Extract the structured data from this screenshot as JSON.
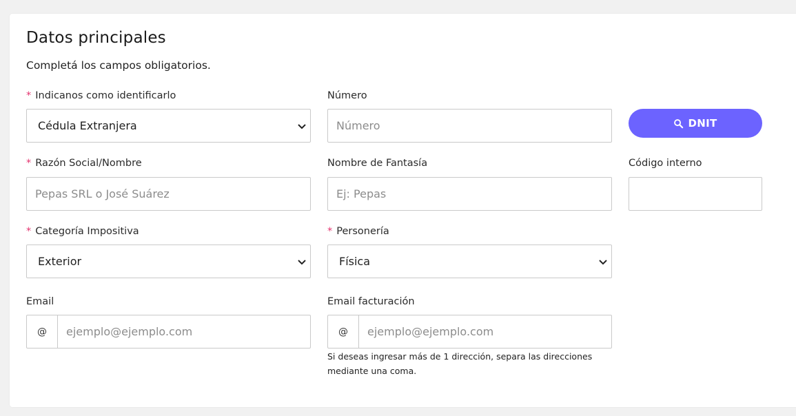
{
  "section": {
    "title": "Datos principales",
    "subtitle": "Completá los campos obligatorios."
  },
  "fields": {
    "identificacion": {
      "label": "Indicanos como identificarlo",
      "required": true,
      "value": "Cédula Extranjera"
    },
    "numero": {
      "label": "Número",
      "placeholder": "Número",
      "value": ""
    },
    "dnit_button": {
      "label": "DNIT",
      "icon": "search-icon"
    },
    "razon_social": {
      "label": "Razón Social/Nombre",
      "required": true,
      "placeholder": "Pepas SRL o José Suárez",
      "value": ""
    },
    "nombre_fantasia": {
      "label": "Nombre de Fantasía",
      "placeholder": "Ej: Pepas",
      "value": ""
    },
    "codigo_interno": {
      "label": "Código interno",
      "placeholder": "",
      "value": ""
    },
    "categoria_impositiva": {
      "label": "Categoría Impositiva",
      "required": true,
      "value": "Exterior"
    },
    "personeria": {
      "label": "Personería",
      "required": true,
      "value": "Física"
    },
    "email": {
      "label": "Email",
      "addon": "@",
      "placeholder": "ejemplo@ejemplo.com",
      "value": ""
    },
    "email_facturacion": {
      "label": "Email facturación",
      "addon": "@",
      "placeholder": "ejemplo@ejemplo.com",
      "value": "",
      "hint": "Si deseas ingresar más de 1 dirección, separa las direcciones mediante una coma."
    }
  },
  "colors": {
    "accent": "#6c63ff",
    "required_asterisk": "#e4336f",
    "border": "#c9c9c9",
    "background": "#f1f1f1"
  }
}
